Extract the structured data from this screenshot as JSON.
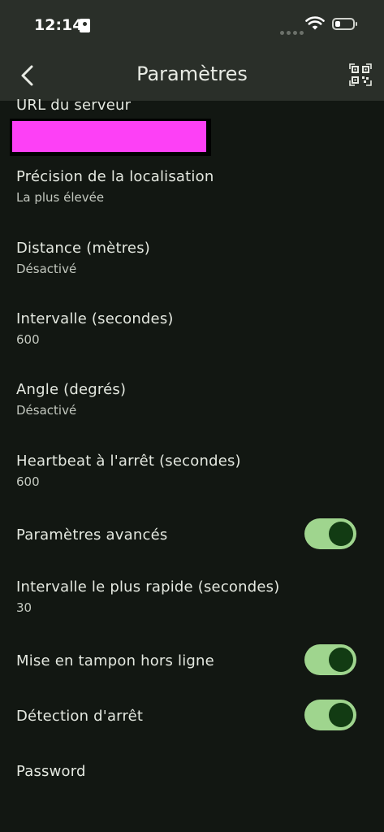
{
  "status_bar": {
    "time": "12:14"
  },
  "header": {
    "title": "Paramètres",
    "back_icon": "chevron-left-icon",
    "qr_icon": "qr-code-scan-icon"
  },
  "settings": [
    {
      "label": "URL du serveur",
      "value": ""
    },
    {
      "label": "Précision de la localisation",
      "value": "La plus élevée"
    },
    {
      "label": "Distance (mètres)",
      "value": "Désactivé"
    },
    {
      "label": "Intervalle (secondes)",
      "value": "600"
    },
    {
      "label": "Angle (degrés)",
      "value": "Désactivé"
    },
    {
      "label": "Heartbeat à l'arrêt (secondes)",
      "value": "600"
    },
    {
      "label": "Paramètres avancés",
      "toggle": true
    },
    {
      "label": "Intervalle le plus rapide (secondes)",
      "value": "30"
    },
    {
      "label": "Mise en tampon hors ligne",
      "toggle": true
    },
    {
      "label": "Détection d'arrêt",
      "toggle": true
    },
    {
      "label": "Password"
    }
  ],
  "colors": {
    "accent_track": "#9fd58e",
    "accent_thumb": "#123b13",
    "background": "#121712",
    "bar": "#2a2f29"
  }
}
